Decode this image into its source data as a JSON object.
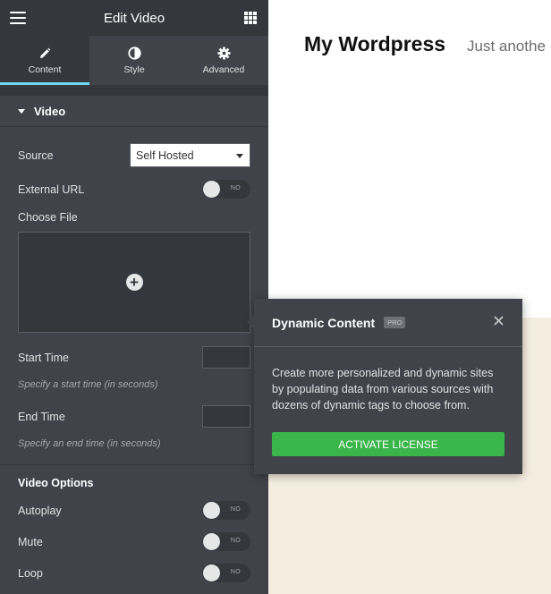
{
  "panel": {
    "title": "Edit Video",
    "tabs": [
      {
        "label": "Content",
        "icon": "pencil-icon"
      },
      {
        "label": "Style",
        "icon": "half-circle-icon"
      },
      {
        "label": "Advanced",
        "icon": "gear-icon"
      }
    ],
    "section": {
      "label": "Video"
    },
    "source": {
      "label": "Source",
      "value": "Self Hosted"
    },
    "external_url": {
      "label": "External URL",
      "toggle": "NO"
    },
    "choose_file": {
      "label": "Choose File"
    },
    "start_time": {
      "label": "Start Time",
      "hint": "Specify a start time (in seconds)"
    },
    "end_time": {
      "label": "End Time",
      "hint": "Specify an end time (in seconds)"
    },
    "video_options": {
      "label": "Video Options"
    },
    "autoplay": {
      "label": "Autoplay",
      "toggle": "NO"
    },
    "mute": {
      "label": "Mute",
      "toggle": "NO"
    },
    "loop": {
      "label": "Loop",
      "toggle": "NO"
    }
  },
  "preview": {
    "site_title": "My Wordpress",
    "tagline": "Just anothe"
  },
  "popup": {
    "title": "Dynamic Content",
    "badge": "PRO",
    "body": "Create more personalized and dynamic sites by populating data from various sources with dozens of dynamic tags to choose from.",
    "button": "ACTIVATE LICENSE"
  },
  "colors": {
    "panel_bg": "#404349",
    "panel_dark": "#34383c",
    "tab_accent": "#71d7f7",
    "activate_green": "#39b54a",
    "preview_cream": "#f5eee0"
  }
}
